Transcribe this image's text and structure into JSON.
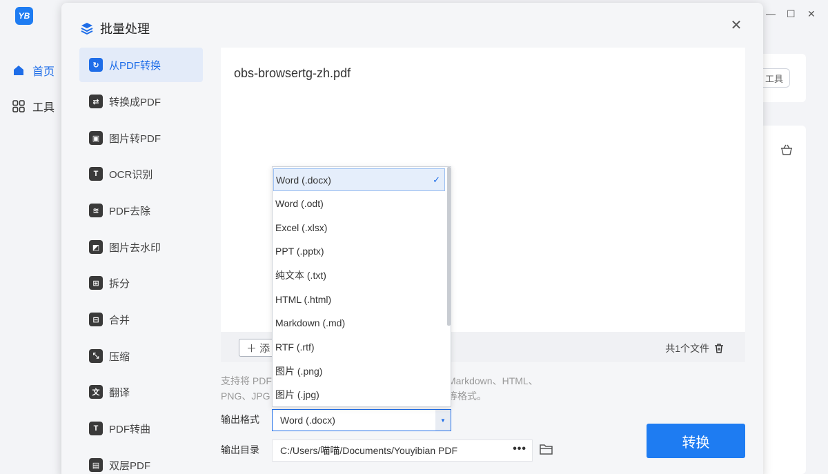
{
  "app": {
    "logo_text": "YB",
    "nav": [
      {
        "label": "首页",
        "icon": "home-icon"
      },
      {
        "label": "工具",
        "icon": "grid-icon"
      }
    ],
    "tool_button": "工具"
  },
  "dialog": {
    "title": "批量处理",
    "close": "✕",
    "sidebar": [
      {
        "label": "从PDF转换",
        "icon": "convert-from-pdf-icon",
        "glyph": "↻"
      },
      {
        "label": "转换成PDF",
        "icon": "convert-to-pdf-icon",
        "glyph": "⇄"
      },
      {
        "label": "图片转PDF",
        "icon": "image-to-pdf-icon",
        "glyph": "▣"
      },
      {
        "label": "OCR识别",
        "icon": "ocr-icon",
        "glyph": "T"
      },
      {
        "label": "PDF去除",
        "icon": "pdf-remove-icon",
        "glyph": "≋"
      },
      {
        "label": "图片去水印",
        "icon": "watermark-remove-icon",
        "glyph": "◩"
      },
      {
        "label": "拆分",
        "icon": "split-icon",
        "glyph": "⊞"
      },
      {
        "label": "合并",
        "icon": "merge-icon",
        "glyph": "⊟"
      },
      {
        "label": "压缩",
        "icon": "compress-icon",
        "glyph": "⤡"
      },
      {
        "label": "翻译",
        "icon": "translate-icon",
        "glyph": "文"
      },
      {
        "label": "PDF转曲",
        "icon": "pdf-outline-icon",
        "glyph": "T"
      },
      {
        "label": "双层PDF",
        "icon": "dual-layer-pdf-icon",
        "glyph": "▤"
      }
    ],
    "file_name": "obs-browsertg-zh.pdf",
    "add_button": "＋ 添",
    "file_count": "共1个文件",
    "support_text_line1": "支持将 PDF",
    "support_text_line1_end": "Markdown、HTML、",
    "support_text_line2": "PNG、JPG",
    "support_text_line2_end": "等格式。",
    "output_format_label": "输出格式",
    "output_format_value": "Word (.docx)",
    "output_dir_label": "输出目录",
    "output_dir_value": "C:/Users/喵喵/Documents/Youyibian PDF",
    "output_dir_more": "•••",
    "convert_button": "转换"
  },
  "dropdown": {
    "options": [
      "Word (.docx)",
      "Word (.odt)",
      "Excel (.xlsx)",
      "PPT (.pptx)",
      "纯文本 (.txt)",
      "HTML (.html)",
      "Markdown (.md)",
      "RTF (.rtf)",
      "图片 (.png)",
      "图片 (.jpg)"
    ],
    "selected_check": "✓"
  },
  "colors": {
    "accent": "#1e7cf2",
    "selected_bg": "#e5eefb"
  }
}
